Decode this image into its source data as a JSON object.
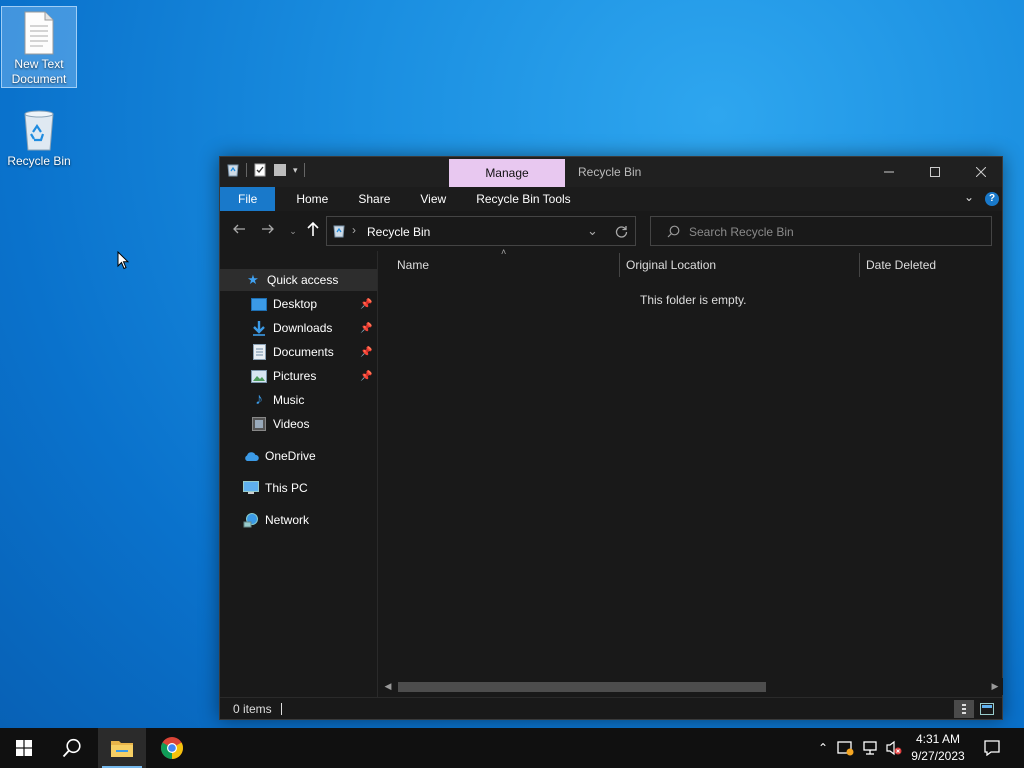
{
  "desktop": {
    "icons": [
      {
        "label": "New Text Document"
      },
      {
        "label": "Recycle Bin"
      }
    ]
  },
  "window": {
    "title": "Recycle Bin",
    "context_tab": "Manage",
    "ribbon_tabs": [
      "File",
      "Home",
      "Share",
      "View",
      "Recycle Bin Tools"
    ],
    "address": {
      "crumb": "Recycle Bin"
    },
    "search": {
      "placeholder": "Search Recycle Bin"
    },
    "nav": {
      "quick_access": "Quick access",
      "items": [
        "Desktop",
        "Downloads",
        "Documents",
        "Pictures",
        "Music",
        "Videos"
      ],
      "onedrive": "OneDrive",
      "this_pc": "This PC",
      "network": "Network"
    },
    "columns": [
      "Name",
      "Original Location",
      "Date Deleted"
    ],
    "empty_message": "This folder is empty.",
    "status": {
      "count": "0 items"
    }
  },
  "taskbar": {
    "time": "4:31 AM",
    "date": "9/27/2023"
  },
  "colors": {
    "accent": "#1979ca",
    "manage_tab": "#e8c8f0",
    "window_bg": "#191919"
  }
}
